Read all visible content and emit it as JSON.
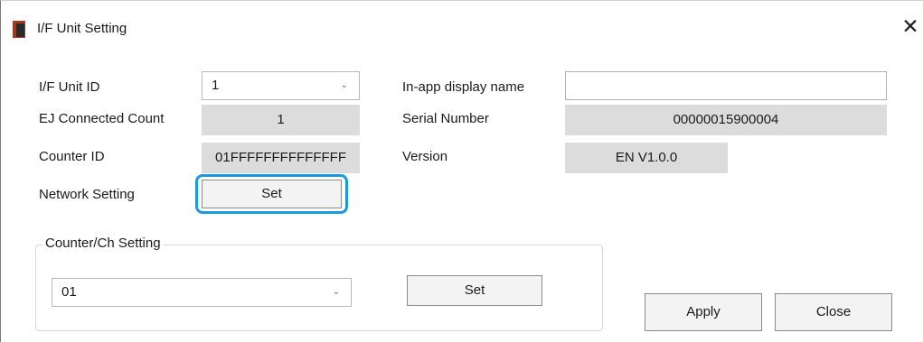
{
  "window": {
    "title": "I/F Unit Setting",
    "title_icon": "app-icon",
    "close_icon": "close-icon",
    "close_glyph": "✕"
  },
  "form": {
    "if_unit_id": {
      "label": "I/F Unit ID",
      "value": "1"
    },
    "ej_connected_count": {
      "label": "EJ Connected Count",
      "value": "1"
    },
    "counter_id": {
      "label": "Counter ID",
      "value": "01FFFFFFFFFFFFFF"
    },
    "network_setting": {
      "label": "Network Setting",
      "button": "Set"
    },
    "display_name": {
      "label": "In-app display name",
      "value": "",
      "placeholder": ""
    },
    "serial_number": {
      "label": "Serial Number",
      "value": "00000015900004"
    },
    "version": {
      "label": "Version",
      "value": "EN V1.0.0"
    }
  },
  "counter_group": {
    "title": "Counter/Ch Setting",
    "selected": "01",
    "set_button": "Set"
  },
  "footer": {
    "apply": "Apply",
    "close": "Close"
  },
  "colors": {
    "highlight": "#1a9bdf",
    "readonly_bg": "#dcdcdc",
    "icon_red": "#a83a1a"
  }
}
